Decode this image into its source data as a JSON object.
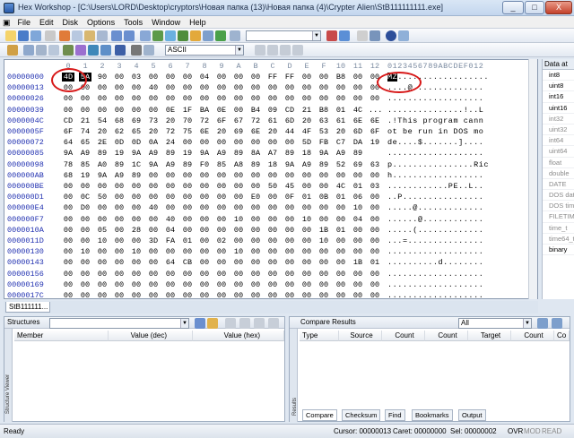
{
  "window": {
    "title": "Hex Workshop - [C:\\Users\\LORD\\Desktop\\cryptors\\Новая папка (13)\\Новая папка (4)\\Crypter Alien\\StB111111111.exe]",
    "minimize": "_",
    "maximize": "□",
    "close": "X"
  },
  "menu": [
    "File",
    "Edit",
    "Disk",
    "Options",
    "Tools",
    "Window",
    "Help"
  ],
  "toolbar2": {
    "encoding": "ASCII"
  },
  "colors": {
    "highlight": "#000000",
    "offset": "#2030b0",
    "annotation": "#d71818",
    "header_col": "#7a8aa0"
  },
  "hex": {
    "columns": [
      "0",
      "1",
      "2",
      "3",
      "4",
      "5",
      "6",
      "7",
      "8",
      "9",
      "A",
      "B",
      "C",
      "D",
      "E",
      "F",
      "10",
      "11",
      "12"
    ],
    "ascii_header": "0123456789ABCDEF012",
    "rows": [
      {
        "off": "00000000",
        "bytes": [
          "4D",
          "5A",
          "90",
          "00",
          "03",
          "00",
          "00",
          "00",
          "04",
          "00",
          "00",
          "00",
          "FF",
          "FF",
          "00",
          "00",
          "B8",
          "00",
          "00"
        ],
        "ascii": "MZ.................."
      },
      {
        "off": "00000013",
        "bytes": [
          "00",
          "00",
          "00",
          "00",
          "00",
          "40",
          "00",
          "00",
          "00",
          "00",
          "00",
          "00",
          "00",
          "00",
          "00",
          "00",
          "00",
          "00",
          "00"
        ],
        "ascii": "....@.............."
      },
      {
        "off": "00000026",
        "bytes": [
          "00",
          "00",
          "00",
          "00",
          "00",
          "00",
          "00",
          "00",
          "00",
          "00",
          "00",
          "00",
          "00",
          "00",
          "00",
          "00",
          "00",
          "00",
          "00"
        ],
        "ascii": "..................."
      },
      {
        "off": "00000039",
        "bytes": [
          "00",
          "00",
          "00",
          "00",
          "00",
          "00",
          "0E",
          "1F",
          "BA",
          "0E",
          "00",
          "B4",
          "09",
          "CD",
          "21",
          "B8",
          "01",
          "4C",
          "..."
        ],
        "ascii": "...............!..L"
      },
      {
        "off": "0000004C",
        "bytes": [
          "CD",
          "21",
          "54",
          "68",
          "69",
          "73",
          "20",
          "70",
          "72",
          "6F",
          "67",
          "72",
          "61",
          "6D",
          "20",
          "63",
          "61",
          "6E",
          "6E"
        ],
        "ascii": ".!This program cann"
      },
      {
        "off": "0000005F",
        "bytes": [
          "6F",
          "74",
          "20",
          "62",
          "65",
          "20",
          "72",
          "75",
          "6E",
          "20",
          "69",
          "6E",
          "20",
          "44",
          "4F",
          "53",
          "20",
          "6D",
          "6F"
        ],
        "ascii": "ot be run in DOS mo"
      },
      {
        "off": "00000072",
        "bytes": [
          "64",
          "65",
          "2E",
          "0D",
          "0D",
          "0A",
          "24",
          "00",
          "00",
          "00",
          "00",
          "00",
          "00",
          "00",
          "5D",
          "FB",
          "C7",
          "DA",
          "19"
        ],
        "ascii": "de....$.......]...."
      },
      {
        "off": "00000085",
        "bytes": [
          "9A",
          "A9",
          "89",
          "19",
          "9A",
          "A9",
          "89",
          "19",
          "9A",
          "A9",
          "89",
          "8A",
          "A7",
          "89",
          "18",
          "9A",
          "A9",
          "89",
          ""
        ],
        "ascii": "..................."
      },
      {
        "off": "00000098",
        "bytes": [
          "78",
          "85",
          "A0",
          "89",
          "1C",
          "9A",
          "A9",
          "89",
          "F0",
          "85",
          "A8",
          "89",
          "18",
          "9A",
          "A9",
          "89",
          "52",
          "69",
          "63"
        ],
        "ascii": "p................Ric"
      },
      {
        "off": "000000AB",
        "bytes": [
          "68",
          "19",
          "9A",
          "A9",
          "89",
          "00",
          "00",
          "00",
          "00",
          "00",
          "00",
          "00",
          "00",
          "00",
          "00",
          "00",
          "00",
          "00",
          "00"
        ],
        "ascii": "h.................."
      },
      {
        "off": "000000BE",
        "bytes": [
          "00",
          "00",
          "00",
          "00",
          "00",
          "00",
          "00",
          "00",
          "00",
          "00",
          "00",
          "00",
          "50",
          "45",
          "00",
          "00",
          "4C",
          "01",
          "03"
        ],
        "ascii": "............PE..L.."
      },
      {
        "off": "000000D1",
        "bytes": [
          "00",
          "0C",
          "50",
          "00",
          "00",
          "00",
          "00",
          "00",
          "00",
          "00",
          "00",
          "E0",
          "00",
          "0F",
          "01",
          "0B",
          "01",
          "06",
          "00"
        ],
        "ascii": "..P................"
      },
      {
        "off": "000000E4",
        "bdummy": "",
        "bytes": [
          "00",
          "D0",
          "00",
          "00",
          "00",
          "40",
          "00",
          "00",
          "00",
          "00",
          "00",
          "00",
          "00",
          "00",
          "00",
          "00",
          "00",
          "10",
          "00"
        ],
        "ascii": ".....@............."
      },
      {
        "off": "000000F7",
        "bytes": [
          "00",
          "00",
          "00",
          "00",
          "00",
          "00",
          "40",
          "00",
          "00",
          "00",
          "10",
          "00",
          "00",
          "00",
          "10",
          "00",
          "00",
          "04",
          "00"
        ],
        "ascii": "......@............"
      },
      {
        "off": "0000010A",
        "bytes": [
          "00",
          "00",
          "05",
          "00",
          "28",
          "00",
          "04",
          "00",
          "00",
          "00",
          "00",
          "00",
          "00",
          "00",
          "00",
          "1B",
          "01",
          "00",
          "00"
        ],
        "ascii": ".....(............."
      },
      {
        "off": "0000011D",
        "bytes": [
          "00",
          "00",
          "10",
          "00",
          "00",
          "3D",
          "FA",
          "01",
          "00",
          "02",
          "00",
          "00",
          "00",
          "00",
          "00",
          "10",
          "00",
          "00",
          "00"
        ],
        "ascii": "...=..............."
      },
      {
        "off": "00000130",
        "bytes": [
          "00",
          "10",
          "00",
          "00",
          "10",
          "00",
          "00",
          "00",
          "00",
          "00",
          "10",
          "00",
          "00",
          "00",
          "00",
          "00",
          "00",
          "00",
          "00"
        ],
        "ascii": "..................."
      },
      {
        "off": "00000143",
        "bytes": [
          "00",
          "00",
          "00",
          "00",
          "00",
          "00",
          "64",
          "CB",
          "00",
          "00",
          "00",
          "00",
          "00",
          "00",
          "00",
          "00",
          "00",
          "1B",
          "01"
        ],
        "ascii": "..........d........"
      },
      {
        "off": "00000156",
        "bytes": [
          "00",
          "00",
          "00",
          "00",
          "00",
          "00",
          "00",
          "00",
          "00",
          "00",
          "00",
          "00",
          "00",
          "00",
          "00",
          "00",
          "00",
          "00",
          "00"
        ],
        "ascii": "..................."
      },
      {
        "off": "00000169",
        "bytes": [
          "00",
          "00",
          "00",
          "00",
          "00",
          "00",
          "00",
          "00",
          "00",
          "00",
          "00",
          "00",
          "00",
          "00",
          "00",
          "00",
          "00",
          "00",
          "00"
        ],
        "ascii": "..................."
      },
      {
        "off": "0000017C",
        "bytes": [
          "00",
          "00",
          "00",
          "00",
          "00",
          "00",
          "00",
          "00",
          "00",
          "00",
          "00",
          "00",
          "00",
          "00",
          "00",
          "00",
          "00",
          "00",
          "00"
        ],
        "ascii": "..................."
      },
      {
        "off": "0000018F",
        "bytes": [
          "00",
          "00",
          "00",
          "00",
          "00",
          "00",
          "00",
          "00",
          "38",
          "02",
          "00",
          "00",
          "20",
          "00",
          "00",
          "00",
          "00",
          "00",
          "00"
        ],
        "ascii": "........8.........."
      }
    ]
  },
  "file_tab": "StB111111...",
  "inspector": {
    "header": "Data at",
    "items": [
      "int8",
      "uint8",
      "int16",
      "uint16",
      "int32",
      "uint32",
      "int64",
      "uint64",
      "float",
      "double",
      "DATE",
      "DOS date",
      "DOS time",
      "FILETIME",
      "time_t",
      "time64_t",
      "binary"
    ]
  },
  "structures": {
    "title": "Structures",
    "cols": [
      "Member",
      "Value (dec)",
      "Value (hex)"
    ],
    "side": "Structure Viewer"
  },
  "compare": {
    "title": "Compare Results",
    "select": "All",
    "cols": [
      "Type",
      "Source",
      "Count",
      "Count",
      "Target",
      "Count",
      "Co"
    ],
    "side": "Results"
  },
  "bottom_tabs": [
    "Compare",
    "Checksum",
    "Find",
    "Bookmarks",
    "Output"
  ],
  "status": {
    "ready": "Ready",
    "cursor": "Cursor: 00000013",
    "caret": "Caret: 00000000",
    "sel": "Sel: 00000002",
    "ovr": "OVR",
    "mod": "MOD",
    "read": "READ"
  }
}
